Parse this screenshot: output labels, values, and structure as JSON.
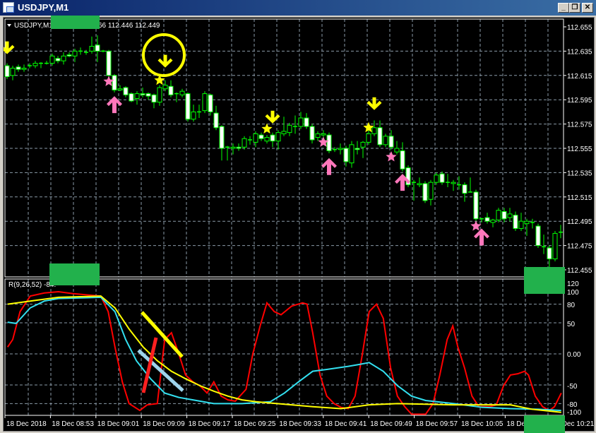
{
  "window": {
    "title": "USDJPY,M1",
    "buttons": {
      "minimize": "_",
      "restore": "❐",
      "close": "✕"
    }
  },
  "chart_header": {
    "symbol": "USDJPY,M1",
    "quote_tail": "66 112.446 112.449"
  },
  "indicator_header": "R(9,26,52) -84.",
  "price_axis": [
    "112.655",
    "112.635",
    "112.615",
    "112.595",
    "112.575",
    "112.555",
    "112.535",
    "112.515",
    "112.495",
    "112.475",
    "112.455"
  ],
  "indicator_axis": [
    "120",
    "100",
    "80",
    "50",
    "0.00",
    "-50",
    "-80",
    "-100"
  ],
  "time_axis": [
    "18 Dec 2018",
    "18 Dec 08:53",
    "18 Dec 09:01",
    "18 Dec 09:09",
    "18 Dec 09:17",
    "18 Dec 09:25",
    "18 Dec 09:33",
    "18 Dec 09:41",
    "18 Dec 09:49",
    "18 Dec 09:57",
    "18 Dec 10:05",
    "18 Dec",
    "18 Dec 10:21"
  ],
  "colors": {
    "bull": "#00ff00",
    "bear_body": "#ffffff",
    "grid": "#8a9aa8",
    "signal_yellow": "#ffff00",
    "signal_pink": "#ff77bb",
    "line_red": "#ff0000",
    "line_yellow": "#ffff00",
    "line_cyan": "#33e0f0"
  },
  "chart_data": {
    "type": "candlestick",
    "symbol": "USDJPY",
    "timeframe": "M1",
    "ylim": [
      112.455,
      112.655
    ],
    "candles_ohlc": [
      [
        112.623,
        112.625,
        112.612,
        112.614
      ],
      [
        112.615,
        112.623,
        112.611,
        112.621
      ],
      [
        112.622,
        112.624,
        112.618,
        112.62
      ],
      [
        112.62,
        112.624,
        112.618,
        112.621
      ],
      [
        112.623,
        112.625,
        112.621,
        112.623
      ],
      [
        112.623,
        112.627,
        112.621,
        112.625
      ],
      [
        112.625,
        112.626,
        112.621,
        112.625
      ],
      [
        112.625,
        112.627,
        112.624,
        112.625
      ],
      [
        112.625,
        112.633,
        112.623,
        112.631
      ],
      [
        112.629,
        112.631,
        112.625,
        112.627
      ],
      [
        112.627,
        112.634,
        112.624,
        112.631
      ],
      [
        112.632,
        112.634,
        112.63,
        112.631
      ],
      [
        112.631,
        112.637,
        112.626,
        112.635
      ],
      [
        112.635,
        112.638,
        112.632,
        112.635
      ],
      [
        112.634,
        112.636,
        112.632,
        112.634
      ],
      [
        112.635,
        112.647,
        112.633,
        112.639
      ],
      [
        112.64,
        112.648,
        112.626,
        112.635
      ],
      [
        112.635,
        112.636,
        112.634,
        112.635
      ],
      [
        112.635,
        112.636,
        112.614,
        112.615
      ],
      [
        112.615,
        112.616,
        112.601,
        112.603
      ],
      [
        112.603,
        112.607,
        112.602,
        112.604
      ],
      [
        112.605,
        112.606,
        112.597,
        112.599
      ],
      [
        112.6,
        112.601,
        112.593,
        112.594
      ],
      [
        112.596,
        112.602,
        112.591,
        112.6
      ],
      [
        112.6,
        112.605,
        112.597,
        112.599
      ],
      [
        112.6,
        112.601,
        112.595,
        112.598
      ],
      [
        112.599,
        112.6,
        112.588,
        112.593
      ],
      [
        112.593,
        112.607,
        112.59,
        112.605
      ],
      [
        112.604,
        112.611,
        112.602,
        112.607
      ],
      [
        112.606,
        112.611,
        112.597,
        112.599
      ],
      [
        112.6,
        112.601,
        112.593,
        112.6
      ],
      [
        112.599,
        112.604,
        112.597,
        112.602
      ],
      [
        112.6,
        112.601,
        112.577,
        112.579
      ],
      [
        112.579,
        112.591,
        112.577,
        112.585
      ],
      [
        112.585,
        112.591,
        112.58,
        112.585
      ],
      [
        112.586,
        112.602,
        112.584,
        112.6
      ],
      [
        112.599,
        112.6,
        112.582,
        112.585
      ],
      [
        112.584,
        112.59,
        112.57,
        112.572
      ],
      [
        112.573,
        112.574,
        112.545,
        112.555
      ],
      [
        112.556,
        112.557,
        112.545,
        112.556
      ],
      [
        112.555,
        112.559,
        112.55,
        112.556
      ],
      [
        112.556,
        112.559,
        112.553,
        112.555
      ],
      [
        112.556,
        112.565,
        112.554,
        112.563
      ],
      [
        112.562,
        112.565,
        112.558,
        112.562
      ],
      [
        112.56,
        112.569,
        112.556,
        112.567
      ],
      [
        112.566,
        112.568,
        112.561,
        112.563
      ],
      [
        112.561,
        112.566,
        112.559,
        112.564
      ],
      [
        112.566,
        112.568,
        112.556,
        112.561
      ],
      [
        112.561,
        112.57,
        112.554,
        112.568
      ],
      [
        112.567,
        112.581,
        112.565,
        112.569
      ],
      [
        112.568,
        112.576,
        112.565,
        112.574
      ],
      [
        112.573,
        112.582,
        112.567,
        112.573
      ],
      [
        112.573,
        112.585,
        112.571,
        112.58
      ],
      [
        112.58,
        112.584,
        112.571,
        112.573
      ],
      [
        112.573,
        112.575,
        112.559,
        112.562
      ],
      [
        112.564,
        112.569,
        112.561,
        112.567
      ],
      [
        112.566,
        112.57,
        112.564,
        112.567
      ],
      [
        112.566,
        112.568,
        112.551,
        112.553
      ],
      [
        112.554,
        112.556,
        112.552,
        112.554
      ],
      [
        112.554,
        112.559,
        112.55,
        112.555
      ],
      [
        112.555,
        112.557,
        112.54,
        112.544
      ],
      [
        112.543,
        112.561,
        112.539,
        112.558
      ],
      [
        112.555,
        112.561,
        112.55,
        112.554
      ],
      [
        112.556,
        112.561,
        112.547,
        112.56
      ],
      [
        112.56,
        112.575,
        112.558,
        112.567
      ],
      [
        112.567,
        112.578,
        112.565,
        112.572
      ],
      [
        112.572,
        112.578,
        112.556,
        112.558
      ],
      [
        112.558,
        112.567,
        112.556,
        112.565
      ],
      [
        112.565,
        112.57,
        112.554,
        112.556
      ],
      [
        112.552,
        112.561,
        112.55,
        112.555
      ],
      [
        112.553,
        112.56,
        112.536,
        112.538
      ],
      [
        112.539,
        112.541,
        112.523,
        112.525
      ],
      [
        112.527,
        112.529,
        112.512,
        112.527
      ],
      [
        112.525,
        112.531,
        112.523,
        112.526
      ],
      [
        112.526,
        112.528,
        112.51,
        112.512
      ],
      [
        112.513,
        112.529,
        112.508,
        112.527
      ],
      [
        112.527,
        112.535,
        112.525,
        112.533
      ],
      [
        112.534,
        112.536,
        112.525,
        112.527
      ],
      [
        112.527,
        112.534,
        112.523,
        112.527
      ],
      [
        112.526,
        112.529,
        112.52,
        112.527
      ],
      [
        112.525,
        112.532,
        112.521,
        112.525
      ],
      [
        112.525,
        112.527,
        112.511,
        112.518
      ],
      [
        112.519,
        112.531,
        112.519,
        112.519
      ],
      [
        112.519,
        112.521,
        112.495,
        112.497
      ],
      [
        112.497,
        112.498,
        112.494,
        112.497
      ],
      [
        112.498,
        112.502,
        112.493,
        112.495
      ],
      [
        112.494,
        112.497,
        112.49,
        112.496
      ],
      [
        112.496,
        112.506,
        112.494,
        112.504
      ],
      [
        112.503,
        112.506,
        112.494,
        112.497
      ],
      [
        112.498,
        112.506,
        112.495,
        112.501
      ],
      [
        112.5,
        112.503,
        112.487,
        112.489
      ],
      [
        112.489,
        112.502,
        112.487,
        112.495
      ],
      [
        112.493,
        112.497,
        112.483,
        112.495
      ],
      [
        112.494,
        112.497,
        112.489,
        112.494
      ],
      [
        112.491,
        112.493,
        112.473,
        112.475
      ],
      [
        112.474,
        112.484,
        112.468,
        112.474
      ],
      [
        112.473,
        112.475,
        112.455,
        112.464
      ],
      [
        112.464,
        112.487,
        112.462,
        112.485
      ],
      [
        112.486,
        112.492,
        112.481,
        112.486
      ]
    ],
    "signals": {
      "sell_arrows": [
        [
          0,
          112.636
        ],
        [
          28,
          112.625
        ],
        [
          47,
          112.579
        ],
        [
          65,
          112.59
        ]
      ],
      "sell_stars": [
        [
          27,
          112.611
        ],
        [
          46,
          112.571
        ],
        [
          64,
          112.572
        ]
      ],
      "buy_stars": [
        [
          18,
          112.61
        ],
        [
          56,
          112.56
        ],
        [
          68,
          112.548
        ],
        [
          83,
          112.491
        ]
      ],
      "buy_arrows": [
        [
          19,
          112.591
        ],
        [
          57,
          112.54
        ],
        [
          70,
          112.527
        ],
        [
          84,
          112.482
        ]
      ]
    },
    "highlight_circle": [
      28,
      112.632
    ],
    "indicator": {
      "name": "R(9,26,52)",
      "ylim": [
        -100,
        120
      ],
      "levels": [
        80,
        50,
        0,
        -50,
        -80
      ],
      "series": [
        {
          "name": "R9",
          "color": "red",
          "points": [
            [
              0.1,
              11
            ],
            [
              1,
              23
            ],
            [
              2.3,
              68
            ],
            [
              4.1,
              93
            ],
            [
              6.6,
              98
            ],
            [
              9.1,
              100
            ],
            [
              11.6,
              97
            ],
            [
              16.6,
              93
            ],
            [
              17.9,
              68
            ],
            [
              19.1,
              11
            ],
            [
              20.4,
              -45
            ],
            [
              21.6,
              -80
            ],
            [
              23.5,
              -91
            ],
            [
              24.8,
              -82
            ],
            [
              26.6,
              -80
            ],
            [
              27.9,
              23
            ],
            [
              29.1,
              34
            ],
            [
              30.4,
              0
            ],
            [
              31.6,
              -34
            ],
            [
              32.9,
              -45
            ],
            [
              34.1,
              -51
            ],
            [
              35.4,
              -63
            ],
            [
              36.6,
              -45
            ],
            [
              37.9,
              -68
            ],
            [
              39.1,
              -74
            ],
            [
              40.4,
              -76
            ],
            [
              42.3,
              -57
            ],
            [
              43.5,
              0
            ],
            [
              44.8,
              45
            ],
            [
              46,
              82
            ],
            [
              47.3,
              68
            ],
            [
              48.5,
              63
            ],
            [
              50.4,
              77
            ],
            [
              52.3,
              82
            ],
            [
              53.1,
              80
            ],
            [
              54.1,
              34
            ],
            [
              55.4,
              -34
            ],
            [
              56.6,
              -68
            ],
            [
              57.9,
              -80
            ],
            [
              59.1,
              -86
            ],
            [
              60.4,
              -88
            ],
            [
              61.6,
              -68
            ],
            [
              62.9,
              0
            ],
            [
              64.1,
              68
            ],
            [
              65.4,
              80
            ],
            [
              66.6,
              57
            ],
            [
              67.9,
              -23
            ],
            [
              69.1,
              -68
            ],
            [
              70.4,
              -85
            ],
            [
              71.6,
              -97
            ],
            [
              74.1,
              -97
            ],
            [
              75.4,
              -80
            ],
            [
              76.6,
              -34
            ],
            [
              77.9,
              23
            ],
            [
              78.9,
              45
            ],
            [
              79.8,
              11
            ],
            [
              81,
              -23
            ],
            [
              82.3,
              -68
            ],
            [
              83.5,
              -85
            ],
            [
              85.4,
              -85
            ],
            [
              86.6,
              -82
            ],
            [
              87.9,
              -51
            ],
            [
              89.1,
              -34
            ],
            [
              90.4,
              -32
            ],
            [
              91.6,
              -28
            ],
            [
              92.3,
              -34
            ],
            [
              93.5,
              -68
            ],
            [
              94.8,
              -85
            ],
            [
              96,
              -91
            ],
            [
              96.9,
              -85
            ],
            [
              98.1,
              -63
            ]
          ]
        },
        {
          "name": "R26",
          "color": "cyan",
          "points": [
            [
              0.1,
              51
            ],
            [
              1.6,
              49
            ],
            [
              4.1,
              74
            ],
            [
              6.6,
              85
            ],
            [
              9.1,
              89
            ],
            [
              16.6,
              91
            ],
            [
              19.1,
              68
            ],
            [
              21,
              23
            ],
            [
              22.9,
              -11
            ],
            [
              25.4,
              -40
            ],
            [
              27.9,
              -63
            ],
            [
              30.4,
              -70
            ],
            [
              32.9,
              -74
            ],
            [
              36.6,
              -80
            ],
            [
              41.6,
              -80
            ],
            [
              46.6,
              -77
            ],
            [
              49.1,
              -63
            ],
            [
              51.6,
              -45
            ],
            [
              54.1,
              -28
            ],
            [
              56.6,
              -25
            ],
            [
              60.4,
              -20
            ],
            [
              62.3,
              -17
            ],
            [
              64.1,
              -14
            ],
            [
              66.6,
              -28
            ],
            [
              69.1,
              -51
            ],
            [
              71.6,
              -68
            ],
            [
              74.1,
              -75
            ],
            [
              79.1,
              -80
            ],
            [
              84.1,
              -86
            ],
            [
              89.1,
              -88
            ],
            [
              94.1,
              -89
            ],
            [
              98.1,
              -91
            ]
          ]
        },
        {
          "name": "R52",
          "color": "yellow",
          "points": [
            [
              0.1,
              80
            ],
            [
              4.1,
              85
            ],
            [
              9.1,
              91
            ],
            [
              16.6,
              93
            ],
            [
              19.1,
              74
            ],
            [
              21.6,
              40
            ],
            [
              24.1,
              11
            ],
            [
              26.6,
              -11
            ],
            [
              29.1,
              -28
            ],
            [
              31.6,
              -40
            ],
            [
              34.1,
              -51
            ],
            [
              36.6,
              -60
            ],
            [
              39.1,
              -68
            ],
            [
              41.6,
              -74
            ],
            [
              44.1,
              -77
            ],
            [
              49.1,
              -81
            ],
            [
              54.1,
              -85
            ],
            [
              59.1,
              -88
            ],
            [
              64.1,
              -82
            ],
            [
              69.1,
              -80
            ],
            [
              74.1,
              -81
            ],
            [
              79.1,
              -82
            ],
            [
              84.1,
              -82
            ],
            [
              89.1,
              -82
            ],
            [
              92.9,
              -89
            ],
            [
              98.1,
              -94
            ]
          ]
        }
      ]
    }
  }
}
